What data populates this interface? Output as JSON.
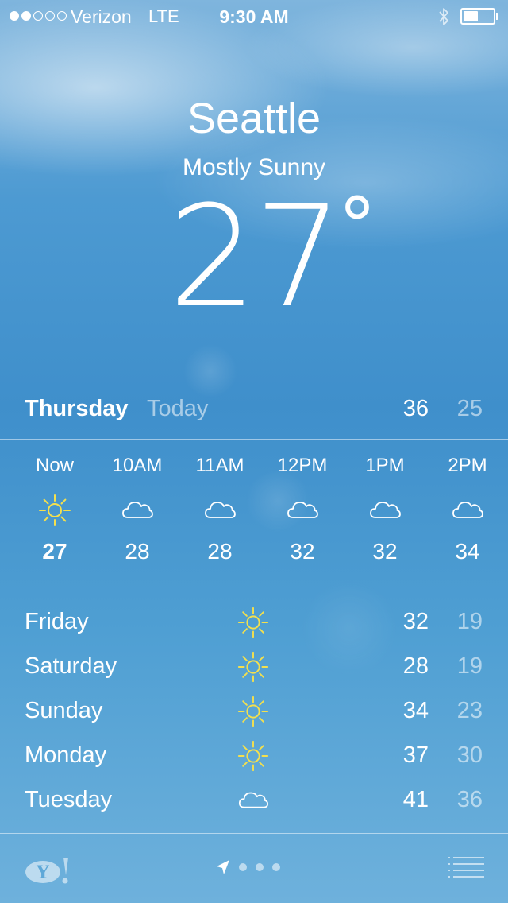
{
  "status_bar": {
    "signal_bars_filled": 2,
    "signal_bars_total": 5,
    "carrier": "Verizon",
    "network": "LTE",
    "time": "9:30 AM",
    "bluetooth_icon": "bluetooth-icon",
    "battery_level": 0.5
  },
  "header": {
    "city": "Seattle",
    "condition": "Mostly Sunny",
    "temperature": "27",
    "degree_symbol": "°"
  },
  "today": {
    "day": "Thursday",
    "label": "Today",
    "high": "36",
    "low": "25"
  },
  "hourly": [
    {
      "time": "Now",
      "icon": "sun-icon",
      "temp": "27"
    },
    {
      "time": "10AM",
      "icon": "cloud-icon",
      "temp": "28"
    },
    {
      "time": "11AM",
      "icon": "cloud-icon",
      "temp": "28"
    },
    {
      "time": "12PM",
      "icon": "cloud-icon",
      "temp": "32"
    },
    {
      "time": "1PM",
      "icon": "cloud-icon",
      "temp": "32"
    },
    {
      "time": "2PM",
      "icon": "cloud-icon",
      "temp": "34"
    }
  ],
  "daily": [
    {
      "day": "Friday",
      "icon": "sun-icon",
      "high": "32",
      "low": "19"
    },
    {
      "day": "Saturday",
      "icon": "sun-icon",
      "high": "28",
      "low": "19"
    },
    {
      "day": "Sunday",
      "icon": "sun-icon",
      "high": "34",
      "low": "23"
    },
    {
      "day": "Monday",
      "icon": "sun-icon",
      "high": "37",
      "low": "30"
    },
    {
      "day": "Tuesday",
      "icon": "cloud-icon",
      "high": "41",
      "low": "36"
    }
  ],
  "bottom_bar": {
    "logo": "yahoo-logo-icon",
    "page_count": 3,
    "list_icon": "list-icon"
  },
  "colors": {
    "sun_yellow": "#f4e04d",
    "sky_blue": "#3f8fcb",
    "text": "#ffffff"
  }
}
